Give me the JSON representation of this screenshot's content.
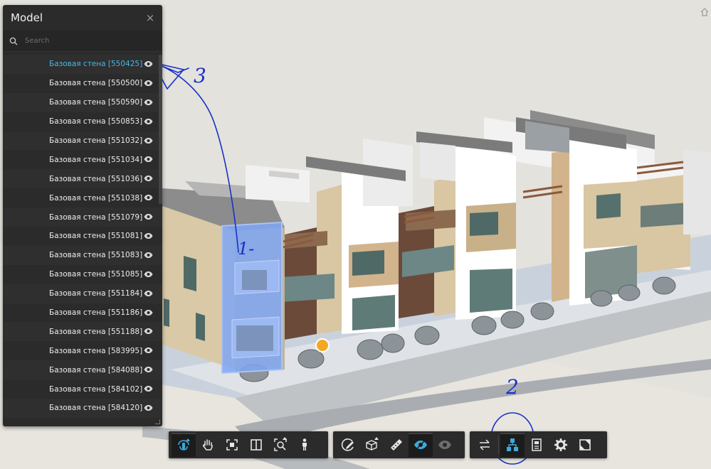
{
  "panel": {
    "title": "Model",
    "close_glyph": "×",
    "search_placeholder": "Search",
    "items": [
      {
        "label": "Базовая стена [550425]",
        "selected": true
      },
      {
        "label": "Базовая стена [550500]",
        "selected": false
      },
      {
        "label": "Базовая стена [550590]",
        "selected": false
      },
      {
        "label": "Базовая стена [550853]",
        "selected": false
      },
      {
        "label": "Базовая стена [551032]",
        "selected": false
      },
      {
        "label": "Базовая стена [551034]",
        "selected": false
      },
      {
        "label": "Базовая стена [551036]",
        "selected": false
      },
      {
        "label": "Базовая стена [551038]",
        "selected": false
      },
      {
        "label": "Базовая стена [551079]",
        "selected": false
      },
      {
        "label": "Базовая стена [551081]",
        "selected": false
      },
      {
        "label": "Базовая стена [551083]",
        "selected": false
      },
      {
        "label": "Базовая стена [551085]",
        "selected": false
      },
      {
        "label": "Базовая стена [551184]",
        "selected": false
      },
      {
        "label": "Базовая стена [551186]",
        "selected": false
      },
      {
        "label": "Базовая стена [551188]",
        "selected": false
      },
      {
        "label": "Базовая стена [583995]",
        "selected": false
      },
      {
        "label": "Базовая стена [584088]",
        "selected": false
      },
      {
        "label": "Базовая стена [584102]",
        "selected": false
      },
      {
        "label": "Базовая стена [584120]",
        "selected": false
      }
    ]
  },
  "toolbar": {
    "groups": [
      [
        "orbit-icon",
        "pan-icon",
        "fit-view-icon",
        "section-icon",
        "zoom-window-icon",
        "first-person-icon"
      ],
      [
        "markup-icon",
        "explode-icon",
        "measure-icon",
        "visibility-icon",
        "ghost-icon"
      ],
      [
        "swap-icon",
        "model-browser-icon",
        "properties-icon",
        "settings-icon",
        "fullscreen-icon"
      ]
    ],
    "active": [
      "orbit-icon",
      "visibility-icon",
      "model-browser-icon"
    ]
  },
  "annotations": {
    "label_1": "1-",
    "label_2": "2",
    "label_3": "3",
    "ink_color": "#1730c8"
  },
  "colors": {
    "accent": "#49b6e6",
    "panel_bg": "#2b2b2b",
    "highlight": "#7fa6f5",
    "marker": "#f5a623"
  }
}
